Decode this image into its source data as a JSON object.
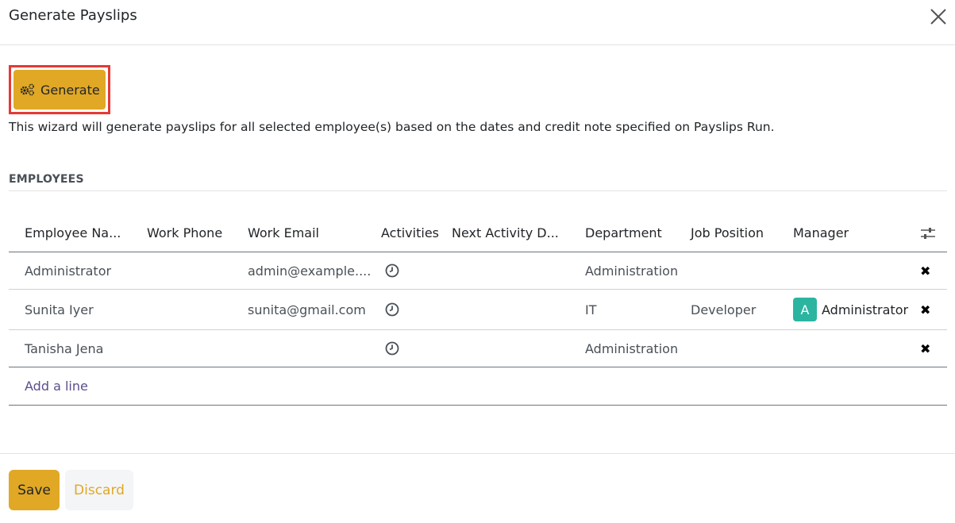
{
  "dialog": {
    "title": "Generate Payslips",
    "close_icon": "close-icon"
  },
  "generate_button": {
    "label": "Generate",
    "icon": "gears-icon",
    "highlight_color": "#e53935"
  },
  "description": "This wizard will generate payslips for all selected employee(s) based on the dates and credit note specified on Payslips Run.",
  "employees_section": {
    "title": "EMPLOYEES",
    "columns": [
      "Employee Na...",
      "Work Phone",
      "Work Email",
      "Activities",
      "Next Activity D...",
      "Department",
      "Job Position",
      "Manager"
    ],
    "settings_icon": "sliders-icon",
    "rows": [
      {
        "name": "Administrator",
        "phone": "",
        "email": "admin@example....",
        "activity_icon": "clock-icon",
        "next_activity": "",
        "department": "Administration",
        "job": "",
        "manager": "",
        "manager_initial": ""
      },
      {
        "name": "Sunita Iyer",
        "phone": "",
        "email": "sunita@gmail.com",
        "activity_icon": "clock-icon",
        "next_activity": "",
        "department": "IT",
        "job": "Developer",
        "manager": "Administrator",
        "manager_initial": "A"
      },
      {
        "name": "Tanisha Jena",
        "phone": "",
        "email": "",
        "activity_icon": "clock-icon",
        "next_activity": "",
        "department": "Administration",
        "job": "",
        "manager": "",
        "manager_initial": ""
      }
    ],
    "add_line": "Add a line",
    "remove_icon": "remove-icon"
  },
  "footer": {
    "save": "Save",
    "discard": "Discard"
  },
  "colors": {
    "primary": "#e0a825",
    "avatar": "#2bb5a0",
    "link": "#5b4e8b"
  }
}
